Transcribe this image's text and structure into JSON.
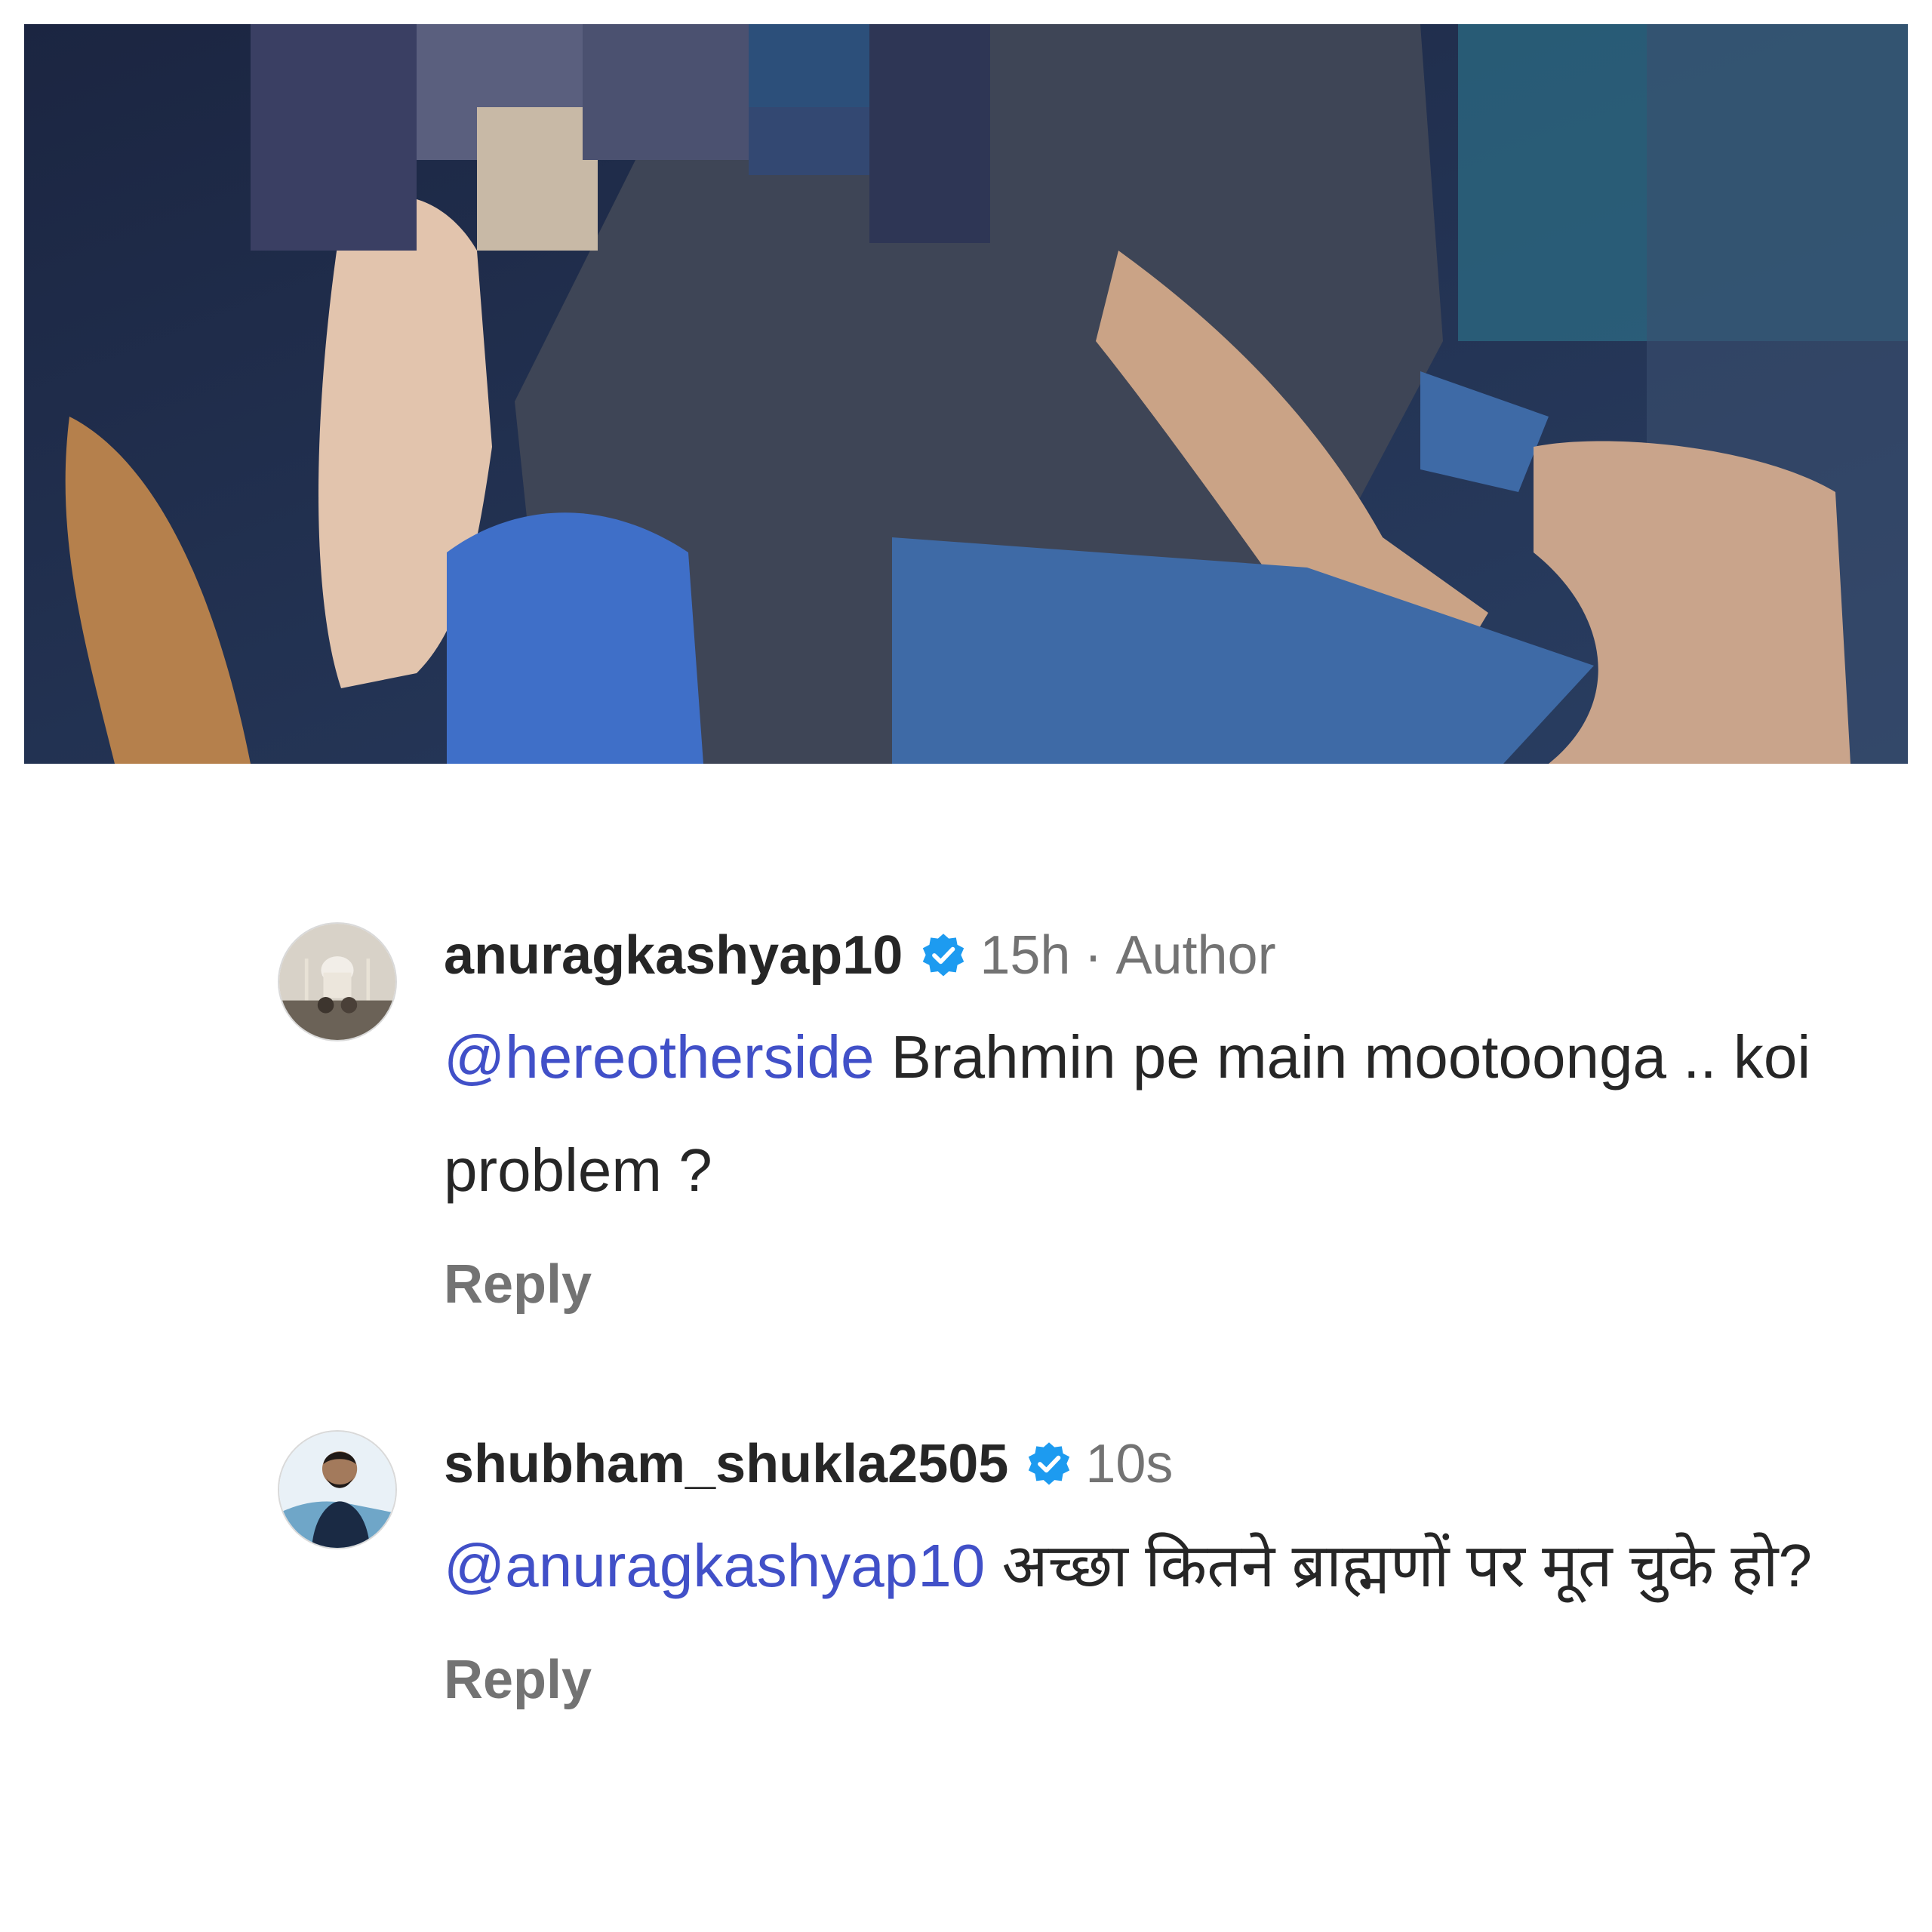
{
  "comments": [
    {
      "username": "anuragkashyap10",
      "time": "15h",
      "separator": "·",
      "tag": "Author",
      "mention": "@hereotherside",
      "text": "Brahmin pe main mootoonga .. koi problem ?",
      "reply_label": "Reply",
      "avatar_icon": "avatar-photo-monument"
    },
    {
      "username": "shubham_shukla2505",
      "time": "10s",
      "mention": "@anuragkashyap10",
      "text": "अच्छा कितने ब्राह्मणों पर मूत चुके हो?",
      "reply_label": "Reply",
      "avatar_icon": "avatar-photo-person"
    }
  ],
  "colors": {
    "mention": "#4150c8",
    "verified_badge": "#1d9bf0",
    "meta_text": "#737373",
    "primary_text": "#262626"
  }
}
